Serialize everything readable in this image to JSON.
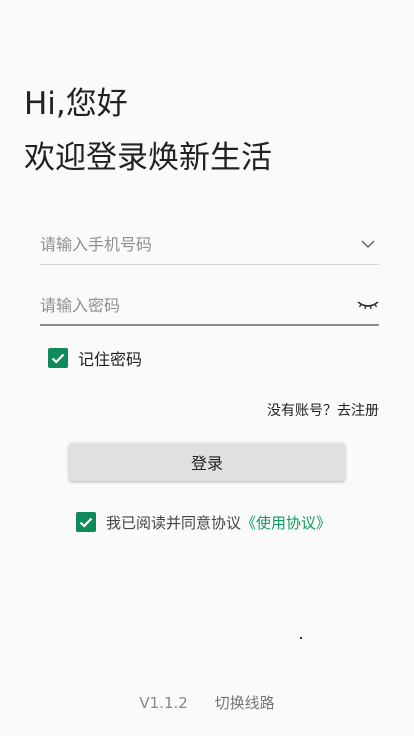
{
  "header": {
    "greeting": "Hi,您好",
    "welcome": "欢迎登录焕新生活"
  },
  "form": {
    "phone": {
      "placeholder": "请输入手机号码",
      "value": "",
      "icon": "chevron-down-icon"
    },
    "password": {
      "placeholder": "请输入密码",
      "value": "",
      "icon": "eye-closed-icon"
    },
    "remember": {
      "label": "记住密码",
      "checked": true
    },
    "register_link": "没有账号？去注册",
    "login_label": "登录",
    "agreement": {
      "checked": true,
      "prefix": "我已阅读并同意协议",
      "link": "《使用协议》"
    }
  },
  "footer": {
    "version": "V1.1.2",
    "switch_line": "切换线路"
  },
  "colors": {
    "accent": "#0f8a5a",
    "link": "#0f9b5e",
    "button_bg": "#e0e0e0"
  }
}
